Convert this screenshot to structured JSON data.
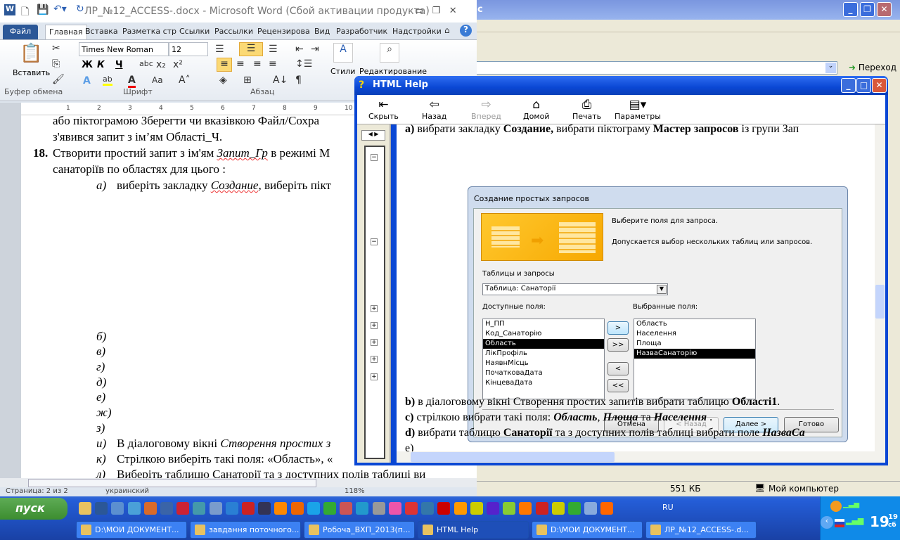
{
  "browser": {
    "title_fragment": "с",
    "address_value": "",
    "go_label": "Переход",
    "status_size": "551 КБ",
    "status_zone": "Мой компьютер"
  },
  "word": {
    "title": "ЛР_№12_ACCESS-.docx  -  Microsoft Word (Сбой активации продукта)",
    "tabs": [
      "Файл",
      "Главная",
      "Вставка",
      "Разметка стр",
      "Ссылки",
      "Рассылки",
      "Рецензирова",
      "Вид",
      "Разработчик",
      "Надстройки"
    ],
    "active_tab": "Главная",
    "ribbon": {
      "paste": "Вставить",
      "font": "Times New Roman",
      "size": "12",
      "styles": "Стили",
      "editing": "Редактирование",
      "groups": [
        "Буфер обмена",
        "Шрифт",
        "Абзац"
      ],
      "bold": "Ж",
      "italic": "К",
      "underline": "Ч"
    },
    "ruler": [
      "1",
      "2",
      "3",
      "4",
      "5",
      "6",
      "7",
      "8",
      "9",
      "10"
    ],
    "doc": {
      "l1": "або піктограмою  Зберегти чи вказівкою Файл/Сохра",
      "l2": "з'явився  запит з ім’ям Області_Ч.",
      "n18": "18.",
      "l3a": "Створити простий запит з ім'ям ",
      "l3b": "Запит_Гр",
      "l3c": " в режимі М",
      "l4": "санаторіїв по областях для цього :",
      "a_lbl": "а)",
      "a1": "виберіть закладку ",
      "a2": "Создание",
      ",a3": ", виберіть пікт",
      "labels": [
        "б)",
        "в)",
        "г)",
        "д)",
        "е)",
        "ж)",
        "з)"
      ],
      "i_lbl": "и)",
      "i1": "В діалоговому вікні ",
      "i2": "Створення простих з",
      "k_lbl": "к)",
      "k1": "Стрілкою виберіть такі поля: «Область», «",
      "l_lbl": "л)",
      "l_text": "Виберіть таблицю Санаторії та з доступних полів таблиці ви"
    },
    "status": {
      "page": "Страница: 2 из 2",
      "lang": "украинский",
      "zoom": "118%"
    }
  },
  "help": {
    "title": "HTML Help",
    "toolbar": [
      {
        "label": "Скрыть",
        "icon": "hide-icon"
      },
      {
        "label": "Назад",
        "icon": "back-arrow-icon"
      },
      {
        "label": "Вперед",
        "icon": "forward-arrow-icon",
        "disabled": true
      },
      {
        "label": "Домой",
        "icon": "home-icon"
      },
      {
        "label": "Печать",
        "icon": "printer-icon"
      },
      {
        "label": "Параметры",
        "icon": "options-icon"
      }
    ],
    "content": {
      "a_pre": "а)",
      "a1": " вибрати закладку ",
      "a2": "Создание,",
      "a3": " вибрати піктограму ",
      "a4": "Мастер запросов",
      "a5": " із групи Зап",
      "b_pre": "b)",
      "b1": " в діалоговому вікні Створення простих запитів вибрати таблицю ",
      "b2": "Області1",
      "c_pre": "c)",
      "c1": "  стрілкою вибрати такі поля: ",
      "c2": "Область",
      "c3": "Площа",
      "c4": "Населення",
      "c_and": " та ",
      "d_pre": "d)",
      "d1": " вибрати таблицю ",
      "d2": "Санаторії",
      "d3": " та з доступних полів таблиці вибрати поле ",
      "d4": "НазваСа",
      "e_pre": "e)"
    },
    "dialog": {
      "title": "Создание простых запросов",
      "intro1": "Выберите поля для запроса.",
      "intro2": "Допускается выбор нескольких таблиц или запросов.",
      "tables_label": "Таблицы и запросы",
      "table_value": "Таблица: Санаторії",
      "available_label": "Доступные поля:",
      "selected_label": "Выбранные поля:",
      "available": [
        "Н_ПП",
        "Код_Санаторію",
        "Область",
        "ЛікПрофіль",
        "НаявнМісць",
        "ПочатковаДата",
        "КінцеваДата"
      ],
      "available_selected": "Область",
      "selected": [
        "Область",
        "Населення",
        "Площа",
        "НазваСанаторію"
      ],
      "selected_selected": "НазваСанаторію",
      "move": [
        ">",
        ">>",
        "<",
        "<<"
      ],
      "cancel": "Отмена",
      "back": "< Назад",
      "next": "Далее >",
      "finish": "Готово"
    }
  },
  "taskbar": {
    "start": "пуск",
    "tasks": [
      "D:\\МОИ ДОКУМЕНТ...",
      "завдання поточного...",
      "Робоча_ВХП_2013(п...",
      "HTML Help",
      "D:\\МОИ ДОКУМЕНТ...",
      "ЛР_№12_ACCESS-.d..."
    ],
    "active_task": "HTML Help",
    "lang": "RU",
    "clock": "19",
    "clock_min": "19",
    "day": "сб"
  }
}
